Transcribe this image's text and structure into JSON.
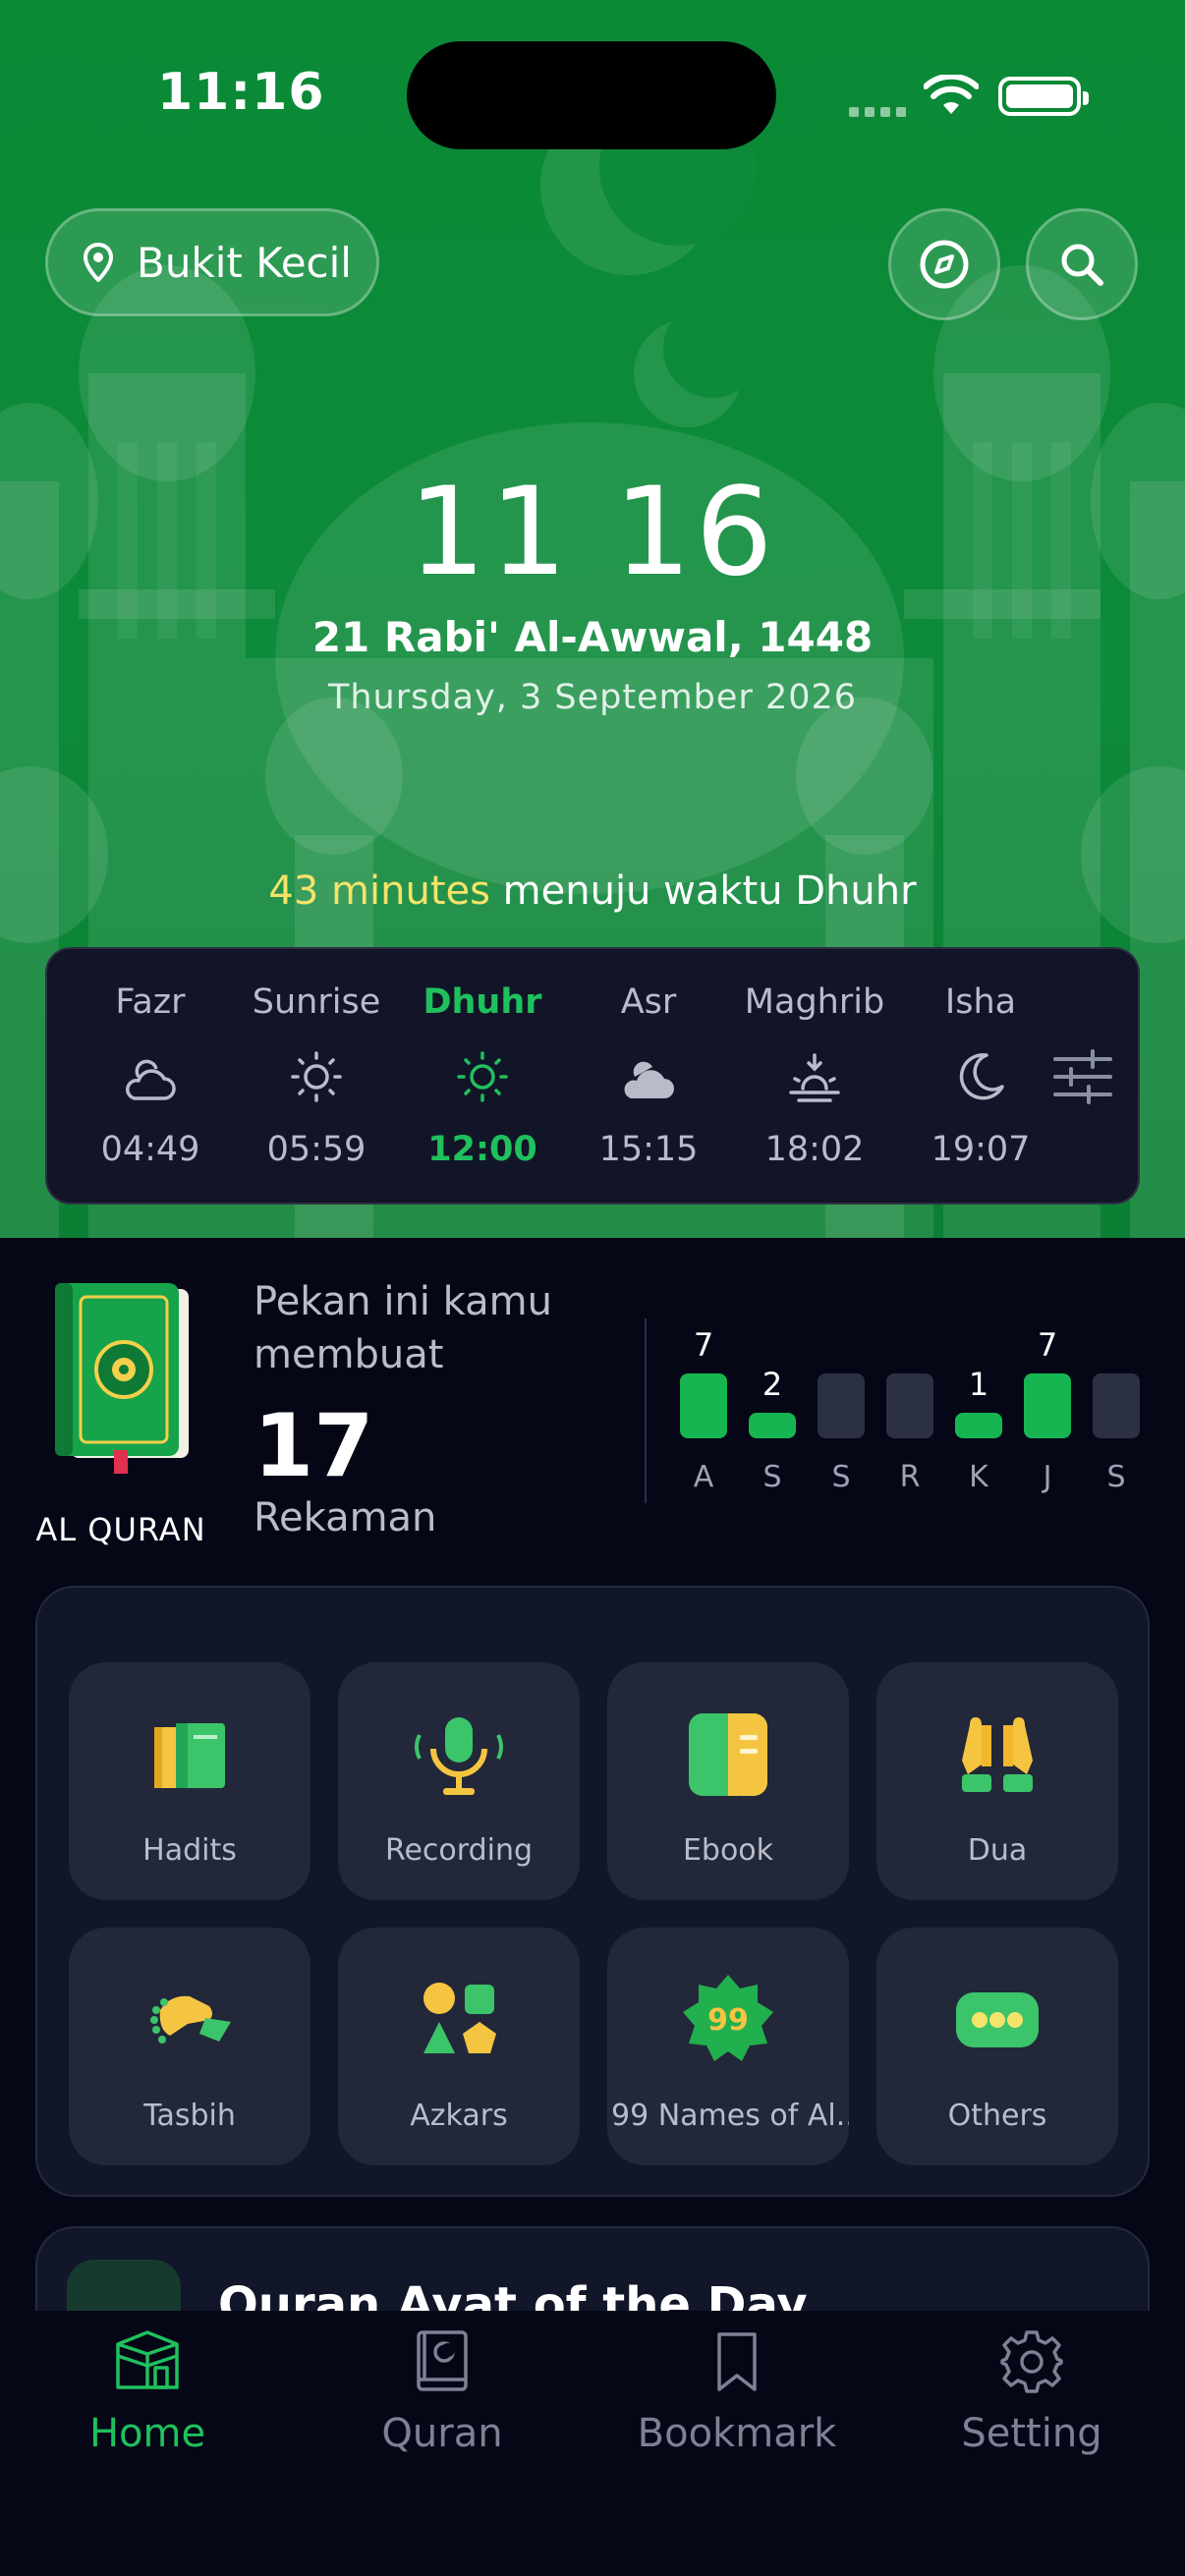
{
  "status_bar": {
    "time": "11:16"
  },
  "header": {
    "location": "Bukit Kecil",
    "clock": "11 16",
    "hijri_date": "21 Rabi' Al-Awwal, 1448",
    "gregorian_date": "Thursday, 3 September 2026",
    "countdown_highlight": "43 minutes",
    "countdown_text": " menuju waktu Dhuhr"
  },
  "prayers": [
    {
      "name": "Fazr",
      "time": "04:49",
      "icon": "cloud-sun-icon",
      "active": false
    },
    {
      "name": "Sunrise",
      "time": "05:59",
      "icon": "sun-icon",
      "active": false
    },
    {
      "name": "Dhuhr",
      "time": "12:00",
      "icon": "sun-icon",
      "active": true
    },
    {
      "name": "Asr",
      "time": "15:15",
      "icon": "cloud-icon",
      "active": false
    },
    {
      "name": "Maghrib",
      "time": "18:02",
      "icon": "sunset-icon",
      "active": false
    },
    {
      "name": "Isha",
      "time": "19:07",
      "icon": "moon-icon",
      "active": false
    }
  ],
  "quran_stats": {
    "book_label": "AL QURAN",
    "week_text": "Pekan ini kamu membuat",
    "count": "17",
    "unit": "Rekaman",
    "days": [
      {
        "day": "A",
        "value": 7
      },
      {
        "day": "S",
        "value": 2
      },
      {
        "day": "S",
        "value": 0
      },
      {
        "day": "R",
        "value": 0
      },
      {
        "day": "K",
        "value": 1
      },
      {
        "day": "J",
        "value": 7
      },
      {
        "day": "S",
        "value": 0
      }
    ]
  },
  "features": [
    {
      "label": "Hadits",
      "icon": "books-icon"
    },
    {
      "label": "Recording",
      "icon": "microphone-icon"
    },
    {
      "label": "Ebook",
      "icon": "ebook-icon"
    },
    {
      "label": "Dua",
      "icon": "praying-hands-icon"
    },
    {
      "label": "Tasbih",
      "icon": "tasbih-hand-icon"
    },
    {
      "label": "Azkars",
      "icon": "shapes-icon"
    },
    {
      "label": "99 Names of Al...",
      "icon": "99-names-icon"
    },
    {
      "label": "Others",
      "icon": "more-dots-icon"
    }
  ],
  "ayat_card": {
    "title": "Quran Ayat of the Day"
  },
  "bottom_nav": [
    {
      "label": "Home",
      "icon": "home-kaaba-icon",
      "active": true
    },
    {
      "label": "Quran",
      "icon": "quran-book-icon",
      "active": false
    },
    {
      "label": "Bookmark",
      "icon": "bookmark-icon",
      "active": false
    },
    {
      "label": "Setting",
      "icon": "gear-icon",
      "active": false
    }
  ],
  "colors": {
    "brand_green": "#0d8a3a",
    "accent_green": "#1fc15c",
    "highlight_yellow": "#f5e36a",
    "background": "#050717"
  }
}
